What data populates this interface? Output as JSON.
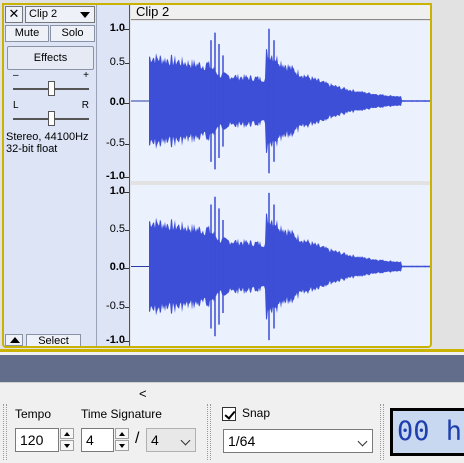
{
  "track": {
    "close_label": "✕",
    "name": "Clip 2",
    "mute_label": "Mute",
    "solo_label": "Solo",
    "effects_label": "Effects",
    "gain_minus": "–",
    "gain_plus": "+",
    "pan_left": "L",
    "pan_right": "R",
    "info_line1": "Stereo, 44100Hz",
    "info_line2": "32-bit float",
    "select_label": "Select"
  },
  "clip": {
    "title": "Clip 2"
  },
  "ruler": {
    "top_channel": [
      "1.0",
      "0.5",
      "0.0",
      "-0.5",
      "-1.0"
    ],
    "bottom_channel": [
      "1.0",
      "0.5",
      "0.0",
      "-0.5",
      "-1.0"
    ]
  },
  "scroll": {
    "left_arrow": "<"
  },
  "toolbar": {
    "tempo_label": "Tempo",
    "tempo_value": "120",
    "time_signature_label": "Time Signature",
    "ts_numerator": "4",
    "ts_separator": "/",
    "ts_denominator": "4",
    "snap_label": "Snap",
    "snap_checked": true,
    "snap_value": "1/64",
    "time_display": "00 h"
  },
  "colors": {
    "waveform": "#3d4fd6",
    "waveform_rms": "#6f7cf0",
    "track_bg": "#ebf1fd",
    "selection_border": "#c9b200",
    "band": "#626d8c"
  }
}
